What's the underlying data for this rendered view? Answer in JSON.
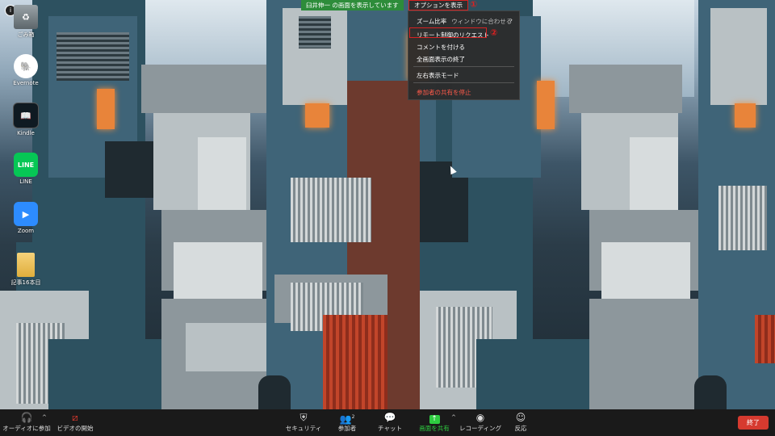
{
  "desktop": {
    "icons": [
      {
        "label": "ごみ箱",
        "icon": "recycle-bin-icon"
      },
      {
        "label": "Evernote",
        "icon": "evernote-icon"
      },
      {
        "label": "Kindle",
        "icon": "kindle-icon"
      },
      {
        "label": "LINE",
        "icon": "line-icon"
      },
      {
        "label": "Zoom",
        "icon": "zoom-icon"
      },
      {
        "label": "記事16本目",
        "icon": "folder-icon"
      }
    ]
  },
  "share_banner": {
    "text": "臼井伸一 の画面を表示しています",
    "options_label": "オプションを表示"
  },
  "annotations": {
    "one": "①",
    "two": "②"
  },
  "menu": {
    "zoom_label": "ズーム比率",
    "zoom_value": "ウィンドウに合わせる",
    "remote_control": "リモート制御のリクエスト",
    "annotate": "コメントを付ける",
    "exit_fullscreen": "全画面表示の終了",
    "side_by_side": "左右表示モード",
    "stop_participant_share": "参加者の共有を停止"
  },
  "toolbar": {
    "join_audio": "オーディオに参加",
    "start_video": "ビデオの開始",
    "security": "セキュリティ",
    "participants": "参加者",
    "participants_count": "2",
    "chat": "チャット",
    "share_screen": "画面を共有",
    "record": "レコーディング",
    "reactions": "反応",
    "end": "終了"
  },
  "colors": {
    "share_green": "#2ecc40",
    "end_red": "#d63a2f",
    "highlight_red": "#d62222"
  }
}
